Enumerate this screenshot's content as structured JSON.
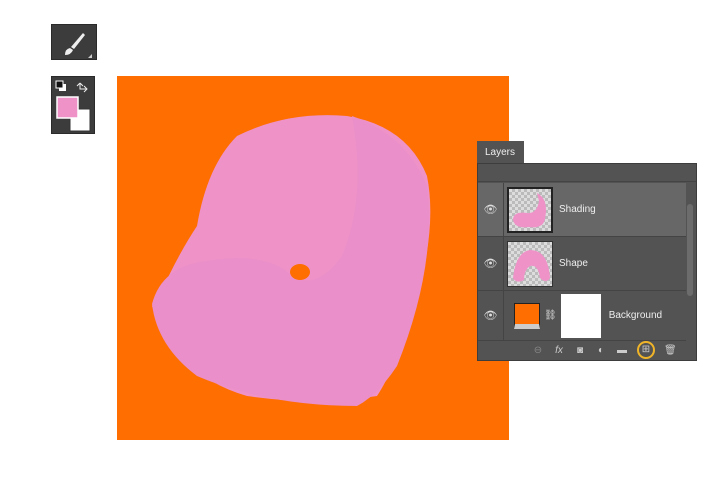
{
  "tools": {
    "brush": "brush-icon",
    "foreground_color": "#ee92c8",
    "background_color": "#ffffff"
  },
  "canvas": {
    "background_color": "#ff6e00",
    "shape_color": "#ee92c8"
  },
  "layers_panel": {
    "tab_label": "Layers",
    "layers": [
      {
        "name": "Shading",
        "selected": true,
        "visible": true
      },
      {
        "name": "Shape",
        "selected": false,
        "visible": true
      },
      {
        "name": "Background",
        "selected": false,
        "visible": true
      }
    ],
    "footer_icons": [
      "link-icon",
      "fx-icon",
      "mask-icon",
      "adjustment-icon",
      "folder-icon",
      "new-layer-icon",
      "trash-icon"
    ],
    "highlight_color": "#f0b429"
  }
}
